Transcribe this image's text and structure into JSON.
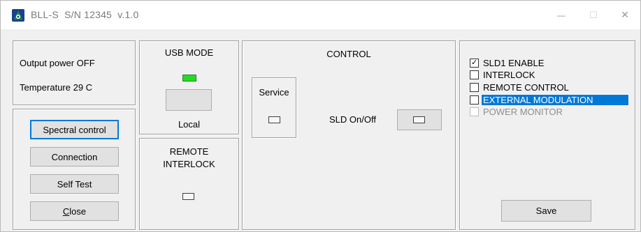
{
  "window": {
    "title": "BLL-S  S/N 12345  v.1.0",
    "controls": {
      "minimize": "—",
      "maximize": "☐",
      "close": "✕"
    }
  },
  "status": {
    "output_power": "Output power OFF",
    "temperature": "Temperature 29 C"
  },
  "usb_mode": {
    "title": "USB MODE",
    "led_color": "#22dd22",
    "mode_label": "Local"
  },
  "remote_interlock": {
    "title_line1": "REMOTE",
    "title_line2": "INTERLOCK"
  },
  "control": {
    "title": "CONTROL",
    "service_label": "Service",
    "sld_label": "SLD On/Off"
  },
  "nav_buttons": {
    "spectral": "Spectral control",
    "connection": "Connection",
    "self_test": "Self Test",
    "close_first": "C",
    "close_rest": "lose"
  },
  "options": [
    {
      "label": "SLD1 ENABLE",
      "checked": true,
      "state": "normal"
    },
    {
      "label": "INTERLOCK",
      "checked": false,
      "state": "normal"
    },
    {
      "label": "REMOTE CONTROL",
      "checked": false,
      "state": "normal"
    },
    {
      "label": "EXTERNAL MODULATION",
      "checked": false,
      "state": "selected"
    },
    {
      "label": "POWER MONITOR",
      "checked": false,
      "state": "disabled"
    }
  ],
  "save_label": "Save",
  "colors": {
    "accent": "#0078d7",
    "led_green": "#22dd22",
    "app_icon_green": "#1b8a3a",
    "app_icon_dark": "#1c3f8f"
  },
  "icons": {
    "app": "laser-app-icon",
    "minimize": "minimize-icon",
    "maximize": "maximize-icon",
    "close": "close-icon"
  }
}
